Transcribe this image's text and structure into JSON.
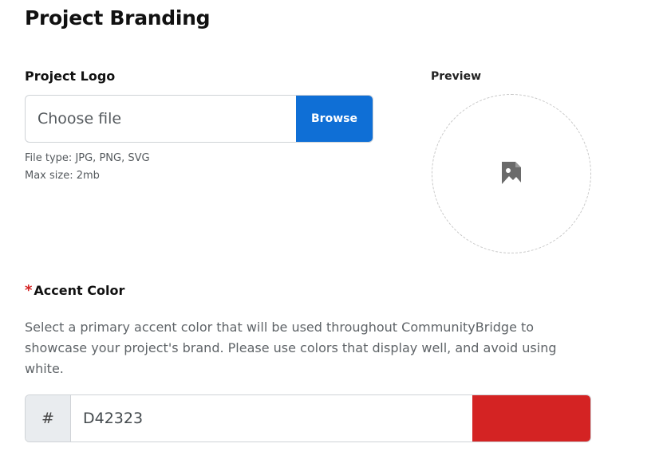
{
  "page": {
    "title": "Project Branding"
  },
  "logo": {
    "label": "Project Logo",
    "file_placeholder": "Choose file",
    "browse_label": "Browse",
    "file_type_hint": "File type: JPG, PNG, SVG",
    "max_size_hint": "Max size: 2mb"
  },
  "preview": {
    "label": "Preview",
    "icon": "image-placeholder-icon"
  },
  "accent": {
    "required_mark": "*",
    "label": "Accent Color",
    "description": "Select a primary accent color that will be used throughout CommunityBridge to showcase your project's brand. Please use colors that display well, and avoid using white.",
    "hash_prefix": "#",
    "hex_value": "D42323",
    "swatch_color": "#D42323"
  },
  "colors": {
    "browse_button": "#0f6fd6",
    "required_mark": "#d42323"
  }
}
